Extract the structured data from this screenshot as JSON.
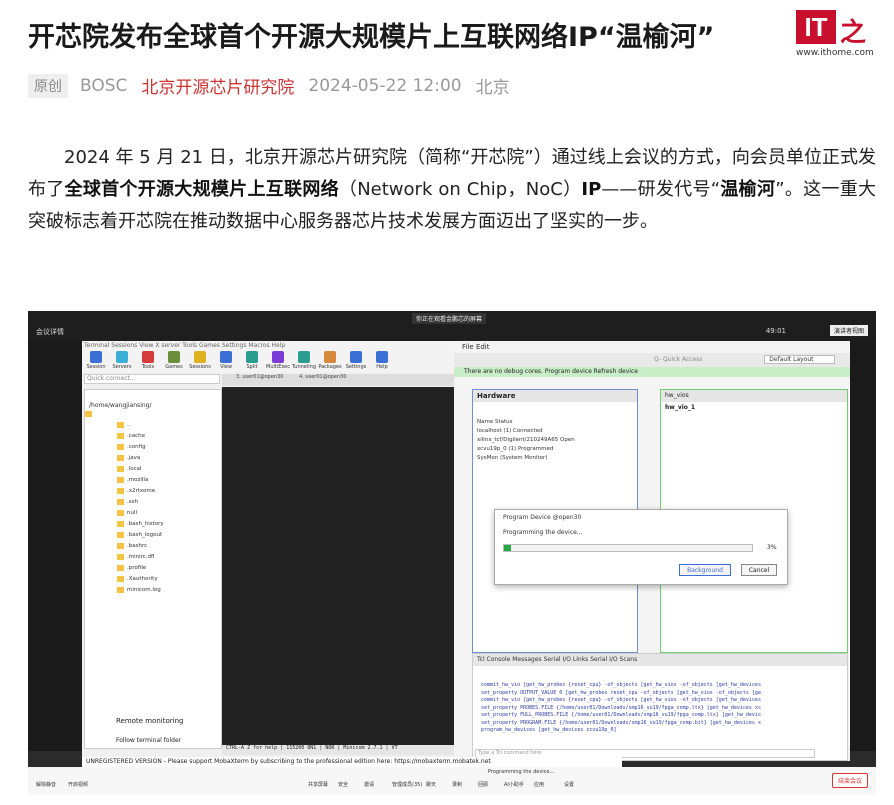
{
  "article": {
    "title": "开芯院发布全球首个开源大规模片上互联网络IP“温榆河”",
    "badge": "原创",
    "source": "BOSC",
    "author": "北京开源芯片研究院",
    "datetime": "2024-05-22 12:00",
    "location": "北京",
    "para_1": "2024 年 5 月 21 日，北京开源芯片研究院（简称“开芯院”）通过线上会议的方式，向会员单位正式发布了",
    "para_bold_1": "全球首个开源大规模片上互联网络",
    "para_2": "（Network on Chip，NoC）",
    "para_bold_2": "IP",
    "para_3": "——研发代号“",
    "para_bold_3": "温榆河",
    "para_4": "”。这一重大突破标志着开芯院在推动数据中心服务器芯片技术发展方面迈出了坚实的一步。"
  },
  "logo": {
    "mark": "IT",
    "zhi": "之",
    "url": "www.ithome.com"
  },
  "screenshot": {
    "topbar": {
      "left": "会议详情",
      "center": "你正在观看金鹏芯的屏幕",
      "right": "演讲者视图",
      "time": "49:01"
    },
    "moba": {
      "menu": "Terminal  Sessions  View  X server  Tools  Games  Settings  Macros  Help",
      "tools": [
        "Session",
        "Servers",
        "Tools",
        "Games",
        "Sessions",
        "View",
        "Split",
        "MultiExec",
        "Tunneling",
        "Packages",
        "Settings",
        "Help"
      ],
      "quick_connect": "Quick connect...",
      "path": "/home/wangjiansing/",
      "tree": [
        "..",
        ".cache",
        ".config",
        ".java",
        ".local",
        ".mozilla",
        ".x2rtxome",
        ".ssh",
        "null",
        ".bash_history",
        ".bash_logout",
        ".bashrc",
        ".minirc.dfl",
        ".profile",
        ".Xauthority",
        "minicom.log"
      ],
      "tab_1": "3. user01@open30",
      "tab_2": "4. user01@open30",
      "status": "CTRL-A Z for help | 115200 8N1 | NOR | Minicom 2.7.1 | VT",
      "remote": "Remote monitoring",
      "follow": "Follow terminal folder",
      "unreg": "UNREGISTERED VERSION  -  Please support MobaXterm by subscribing to the professional edition here:  https://mobaxterm.mobatek.net"
    },
    "vivado": {
      "menu": "File   Edit",
      "quick": "Q- Quick Access",
      "layout": "Default Layout",
      "notice": "There are no debug cores.  Program device  Refresh device",
      "hw_title": "Hardware",
      "rows": [
        "Name                          Status",
        "localhost (1)                 Connected",
        "xilinx_tcf/Digilent/210249A65  Open",
        "xcvu19p_0 (1)                 Programmed",
        "SysMon (System Monitor)"
      ],
      "vio_tab": "hw_vios",
      "vio_name": "hw_vio_1",
      "dialog_title": "Program Device @open30",
      "dialog_msg": "Programming the device...",
      "progress_pct": 3,
      "progress_text": "3%",
      "btn_bg": "Background",
      "btn_cancel": "Cancel",
      "tcl_title": "Tcl Console   Messages   Serial I/O Links   Serial I/O Scans",
      "tcl_lines": [
        "commit_hw_vio [get_hw_probes {reset_cpu} -of_objects [get_hw_vios -of_objects [get_hw_devices",
        "set_property OUTPUT_VALUE 0 [get_hw_probes reset_cpu -of_objects [get_hw_vios -of_objects [ge",
        "commit_hw_vio [get_hw_probes {reset_cpu} -of_objects [get_hw_vios -of_objects [get_hw_devices",
        "set_property PROBES.FILE {/home/user01/Downloads/smp16_vu19/fpga_comp.ltx} [get_hw_devices xc",
        "set_property FULL_PROBES.FILE {/home/user01/Downloads/smp16_vu19/fpga_comp.ltx} [get_hw_devic",
        "set_property PROGRAM.FILE {/home/user01/Downloads/smp16_vu19/fpga_comp.bit} [get_hw_devices x",
        "program_hw_devices [get_hw_devices xcvu19p_0]"
      ],
      "tcl_input": "Type a Tcl command here"
    },
    "taskbar": {
      "items": [
        "解除静音",
        "开启视频",
        "共享屏幕",
        "安全",
        "邀请",
        "管理成员(35)",
        "聊天",
        "录制",
        "回顾",
        "AI小助手",
        "应用",
        "设置"
      ],
      "leave": "结束会议",
      "tray": "Programming the device..."
    }
  }
}
